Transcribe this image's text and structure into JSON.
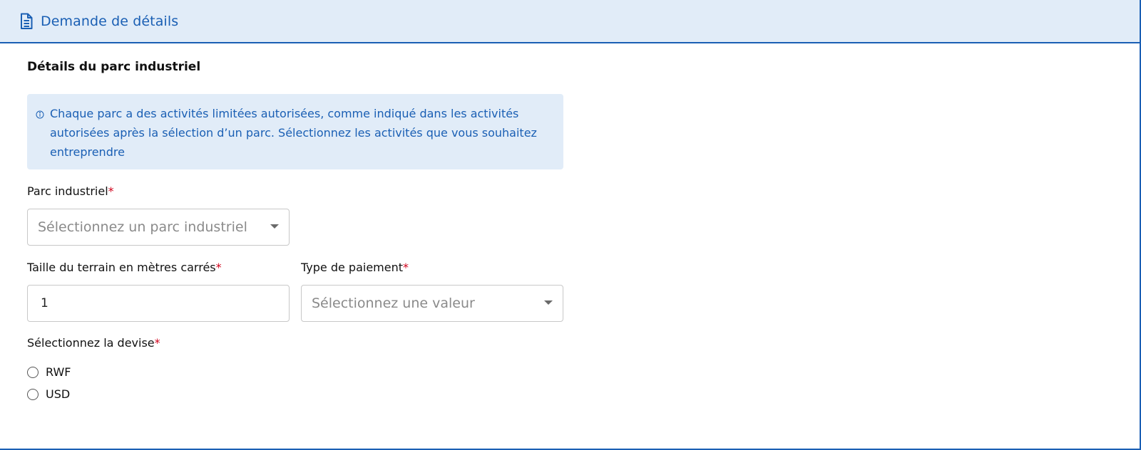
{
  "header": {
    "title": "Demande de détails",
    "icon": "document-icon"
  },
  "section": {
    "title": "Détails du parc industriel"
  },
  "info": {
    "icon": "info-icon",
    "text": "Chaque parc a des activités limitées autorisées, comme indiqué dans les activités autorisées après la sélection d’un parc. Sélectionnez les activités que vous souhaitez entreprendre"
  },
  "fields": {
    "industrial_park": {
      "label": "Parc industriel",
      "required_mark": "*",
      "placeholder": "Sélectionnez un parc industriel"
    },
    "land_size": {
      "label": "Taille du terrain en mètres carrés",
      "required_mark": "*",
      "value": "1"
    },
    "payment_type": {
      "label": "Type de paiement",
      "required_mark": "*",
      "placeholder": "Sélectionnez une valeur"
    },
    "currency": {
      "label": "Sélectionnez la devise",
      "required_mark": "*",
      "options": [
        "RWF",
        "USD"
      ]
    }
  },
  "colors": {
    "accent": "#1a5fb4",
    "header_bg": "#e1ecf8",
    "required": "#d0021b"
  }
}
